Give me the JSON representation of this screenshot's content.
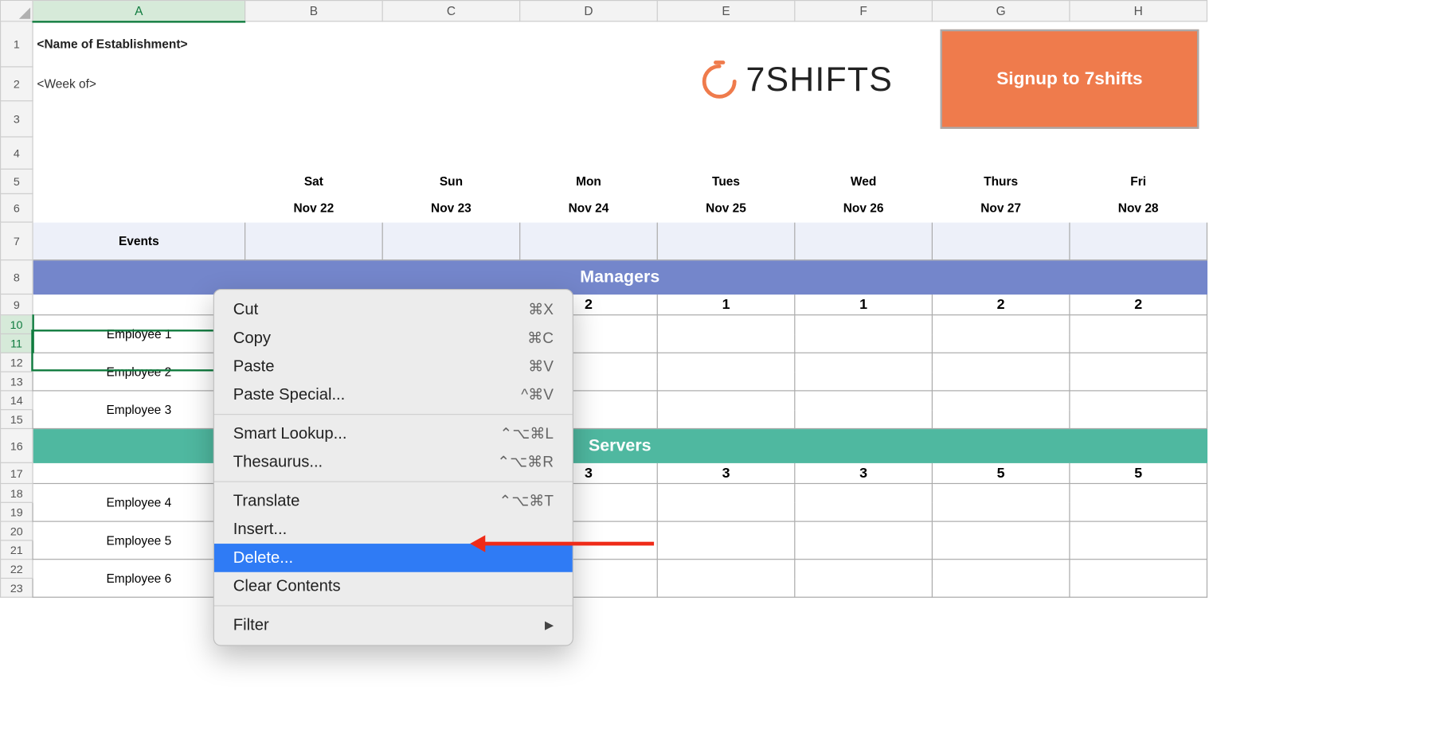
{
  "columns": [
    "A",
    "B",
    "C",
    "D",
    "E",
    "F",
    "G",
    "H"
  ],
  "row_numbers": [
    "1",
    "2",
    "3",
    "4",
    "5",
    "6",
    "7",
    "8",
    "9",
    "10",
    "11",
    "12",
    "13",
    "14",
    "15",
    "16",
    "17",
    "18",
    "19",
    "20",
    "21",
    "22",
    "23"
  ],
  "title": "<Name of Establishment>",
  "subtitle": "<Week of>",
  "logo_text": "7SHIFTS",
  "signup_label": "Signup to 7shifts",
  "days": [
    "Sat",
    "Sun",
    "Mon",
    "Tues",
    "Wed",
    "Thurs",
    "Fri"
  ],
  "dates": [
    "Nov 22",
    "Nov 23",
    "Nov 24",
    "Nov 25",
    "Nov 26",
    "Nov 27",
    "Nov 28"
  ],
  "events_label": "Events",
  "sections": {
    "managers": {
      "label": "Managers",
      "counts": [
        "",
        "",
        "2",
        "1",
        "1",
        "2",
        "2"
      ]
    },
    "servers": {
      "label": "Servers",
      "counts": [
        "",
        "",
        "3",
        "3",
        "3",
        "5",
        "5"
      ]
    }
  },
  "employees_group1": [
    "Employee 1",
    "Employee 2",
    "Employee 3"
  ],
  "employees_group2": [
    "Employee 4",
    "Employee 5",
    "Employee 6"
  ],
  "context_menu": {
    "cut": {
      "label": "Cut",
      "shortcut": "⌘X"
    },
    "copy": {
      "label": "Copy",
      "shortcut": "⌘C"
    },
    "paste": {
      "label": "Paste",
      "shortcut": "⌘V"
    },
    "paste_special": {
      "label": "Paste Special...",
      "shortcut": "^⌘V"
    },
    "smart_lookup": {
      "label": "Smart Lookup...",
      "shortcut": "⌃⌥⌘L"
    },
    "thesaurus": {
      "label": "Thesaurus...",
      "shortcut": "⌃⌥⌘R"
    },
    "translate": {
      "label": "Translate",
      "shortcut": "⌃⌥⌘T"
    },
    "insert": {
      "label": "Insert...",
      "shortcut": ""
    },
    "delete": {
      "label": "Delete...",
      "shortcut": ""
    },
    "clear": {
      "label": "Clear Contents",
      "shortcut": ""
    },
    "filter": {
      "label": "Filter",
      "shortcut": "▶"
    }
  }
}
